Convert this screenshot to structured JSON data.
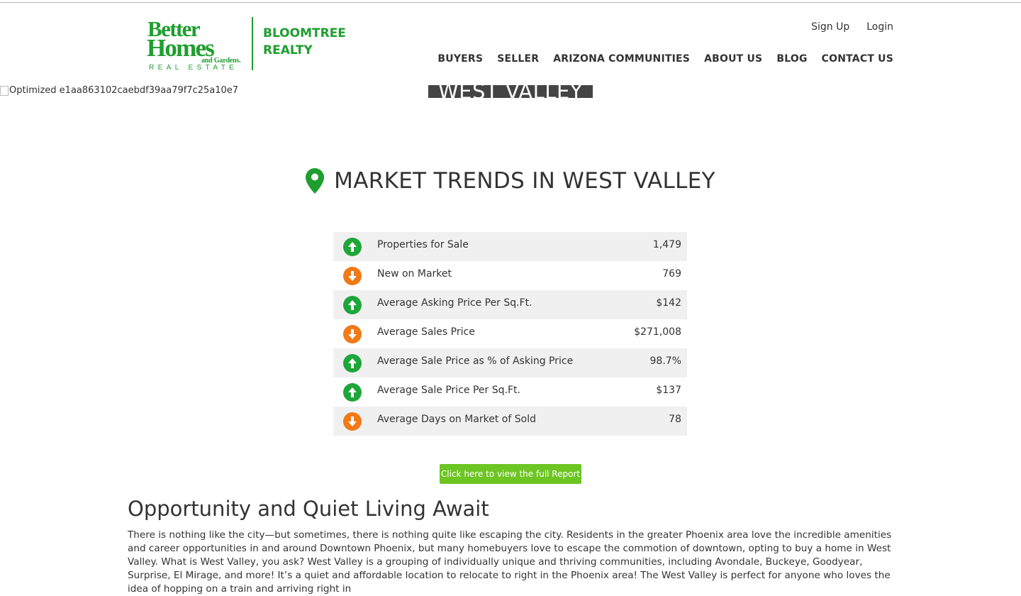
{
  "header": {
    "logo": {
      "line1": "Better",
      "line2": "Homes",
      "line3": "and Gardens.",
      "line4": "REAL ESTATE",
      "brand_line1": "BLOOMTREE",
      "brand_line2": "REALTY"
    },
    "util_nav": [
      "Sign Up",
      "Login"
    ],
    "main_nav": [
      "BUYERS",
      "SELLER",
      "ARIZONA COMMUNITIES",
      "ABOUT US",
      "BLOG",
      "CONTACT US"
    ]
  },
  "hero": {
    "broken_image_alt": "Optimized e1aa863102caebdf39aa79f7c25a10e7",
    "banner_text": "WEST VALLEY"
  },
  "market": {
    "title": "MARKET TRENDS IN WEST VALLEY",
    "stats": [
      {
        "label": "Properties for Sale",
        "value": "1,479",
        "trend": "up"
      },
      {
        "label": "New on Market",
        "value": "769",
        "trend": "down"
      },
      {
        "label": "Average Asking Price Per Sq.Ft.",
        "value": "$142",
        "trend": "up"
      },
      {
        "label": "Average Sales Price",
        "value": "$271,008",
        "trend": "down"
      },
      {
        "label": "Average Sale Price as % of Asking Price",
        "value": "98.7%",
        "trend": "up"
      },
      {
        "label": "Average Sale Price Per Sq.Ft.",
        "value": "$137",
        "trend": "up"
      },
      {
        "label": "Average Days on Market of Sold",
        "value": "78",
        "trend": "down"
      }
    ],
    "report_button": "Click here to view the full Report"
  },
  "content": {
    "heading": "Opportunity and Quiet Living Await",
    "body": "There is nothing like the city—but sometimes, there is nothing quite like escaping the city.  Residents in the greater Phoenix area love the incredible amenities and career opportunities in and around Downtown Phoenix, but many homebuyers love to escape the commotion of downtown, opting to buy a home in West Valley.  What is West Valley, you ask? West Valley is a grouping of individually unique and thriving communities, including Avondale, Buckeye, Goodyear, Surprise, El Mirage, and more! It’s a quiet and affordable location to relocate to right in the Phoenix area!  The West Valley is perfect for anyone who loves the idea of hopping on a train and arriving right in"
  },
  "colors": {
    "brand_green": "#1e9e2e",
    "trend_up": "#1fa63a",
    "trend_down": "#f07a18",
    "button_green": "#6cc523",
    "row_shade": "#f0f0f0"
  }
}
